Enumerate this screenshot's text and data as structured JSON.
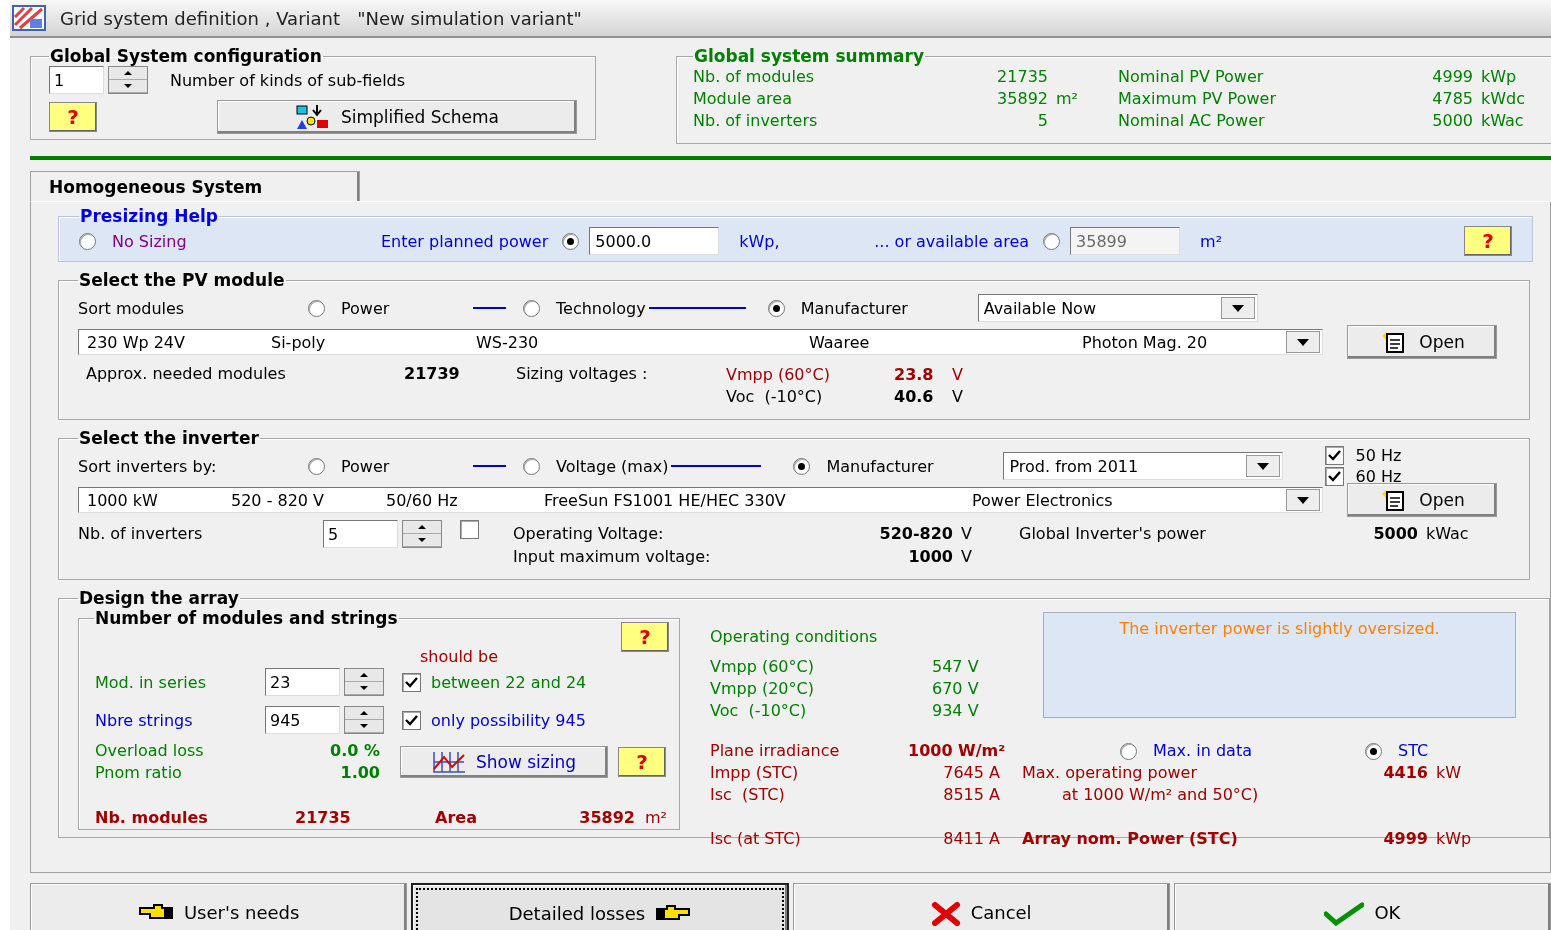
{
  "window": {
    "title": "Grid system definition , Variant   \"New simulation variant\""
  },
  "global_config": {
    "title": "Global System configuration",
    "count": "1",
    "count_label": "Number of kinds of sub-fields",
    "help": "?",
    "schema_button": "Simplified Schema"
  },
  "summary": {
    "title": "Global system summary",
    "rows": [
      {
        "label": "Nb. of modules",
        "value": "21735",
        "label2": "Nominal PV Power",
        "value2": "4999",
        "unit2": "kWp"
      },
      {
        "label": "Module area",
        "value": "35892",
        "unit": "m²",
        "label2": "Maximum PV Power",
        "value2": "4785",
        "unit2": "kWdc"
      },
      {
        "label": "Nb. of inverters",
        "value": "5",
        "label2": "Nominal AC Power",
        "value2": "5000",
        "unit2": "kWac"
      }
    ]
  },
  "tabs": [
    {
      "label": "Homogeneous System",
      "selected": true
    }
  ],
  "presizing": {
    "title": "Presizing Help",
    "no_sizing": {
      "label": "No Sizing",
      "selected": false
    },
    "power": {
      "label": "Enter planned power",
      "selected": true,
      "value": "5000.0",
      "unit": "kWp,",
      "disabled": false
    },
    "area": {
      "label": "... or available area",
      "selected": false,
      "value": "35899",
      "unit": "m²",
      "disabled": true
    },
    "help": "?"
  },
  "pv_module": {
    "title": "Select the PV module",
    "sort_label": "Sort modules",
    "sort_options": [
      {
        "label": "Power",
        "selected": false
      },
      {
        "label": "Technology",
        "selected": false
      },
      {
        "label": "Manufacturer",
        "selected": true
      }
    ],
    "filter": "Available Now",
    "selection": [
      "230 Wp 24V",
      "Si-poly",
      "WS-230",
      "Waaree",
      "Photon Mag. 20"
    ],
    "open_button": "Open",
    "needed_label": "Approx. needed modules",
    "needed_value": "21739",
    "sizing_label": "Sizing voltages :",
    "voltages": [
      {
        "label": "Vmpp (60°C)",
        "value": "23.8",
        "unit": "V",
        "kind": "vmpp"
      },
      {
        "label": "Voc  (-10°C)",
        "value": "40.6",
        "unit": "V",
        "kind": "voc"
      }
    ]
  },
  "inverter": {
    "title": "Select the inverter",
    "sort_label": "Sort inverters by:",
    "sort_options": [
      {
        "label": "Power",
        "selected": false
      },
      {
        "label": "Voltage (max)",
        "selected": false
      },
      {
        "label": "Manufacturer",
        "selected": true
      }
    ],
    "filter": "Prod. from 2011",
    "frequencies": [
      {
        "label": "50 Hz",
        "checked": true
      },
      {
        "label": "60 Hz",
        "checked": true
      }
    ],
    "selection": [
      "1000 kW",
      "520 - 820 V",
      "50/60 Hz",
      "FreeSun FS1001 HE/HEC 330V",
      "Power Electronics"
    ],
    "open_button": "Open",
    "count_label": "Nb. of inverters",
    "count": "5",
    "count_checked": false,
    "op_voltage_label": "Operating Voltage:",
    "op_voltage": "520-820",
    "op_voltage_unit": "V",
    "max_voltage_label": "Input maximum voltage:",
    "max_voltage": "1000",
    "max_voltage_unit": "V",
    "power_label": "Global Inverter's power",
    "power": "5000",
    "power_unit": "kWac"
  },
  "design": {
    "title": "Design the array",
    "strings_box": {
      "title": "Number of modules and strings",
      "help": "?",
      "hint": "should be",
      "series_label": "Mod. in series",
      "series": "23",
      "series_check": {
        "label": "between 22 and 24",
        "checked": true
      },
      "strings_label": "Nbre strings",
      "strings": "945",
      "strings_check": {
        "label": "only possibility 945",
        "checked": true
      },
      "overload_label": "Overload loss",
      "overload": "0.0 %",
      "pnom_label": "Pnom ratio",
      "pnom": "1.00",
      "sizing_button": "Show sizing",
      "help2": "?",
      "modules_label": "Nb. modules",
      "modules": "21735",
      "area_label": "Area",
      "area": "35892",
      "area_unit": "m²"
    },
    "conditions": {
      "title": "Operating conditions",
      "rows": [
        {
          "label": "Vmpp (60°C)",
          "value": "547 V"
        },
        {
          "label": "Vmpp (20°C)",
          "value": "670 V"
        },
        {
          "label": "Voc  (-10°C)",
          "value": "934 V"
        }
      ]
    },
    "message": "The inverter power is slightly oversized.",
    "irradiance": {
      "label": "Plane irradiance",
      "value": "1000 W/m²",
      "options": [
        {
          "label": "Max. in data",
          "selected": false
        },
        {
          "label": "STC",
          "selected": true
        }
      ]
    },
    "currents": [
      {
        "label": "Impp (STC)",
        "value": "7645 A",
        "note": "Max. operating power",
        "result": "4416",
        "unit": "kW",
        "kind": "plain"
      },
      {
        "label": "Isc  (STC)",
        "value": "8515 A",
        "note": "at 1000 W/m² and 50°C)",
        "kind": "indent"
      },
      {
        "label": "Isc (at STC)",
        "value": "8411 A",
        "note": "Array nom. Power (STC)",
        "result": "4999",
        "unit": "kWp",
        "kind": "total"
      }
    ]
  },
  "buttons": [
    {
      "label": "User's needs",
      "kind": "back",
      "focused": false
    },
    {
      "label": "Detailed losses",
      "kind": "next",
      "focused": true
    },
    {
      "label": "Cancel",
      "kind": "cancel",
      "focused": false
    },
    {
      "label": "OK",
      "kind": "ok",
      "focused": false
    }
  ]
}
